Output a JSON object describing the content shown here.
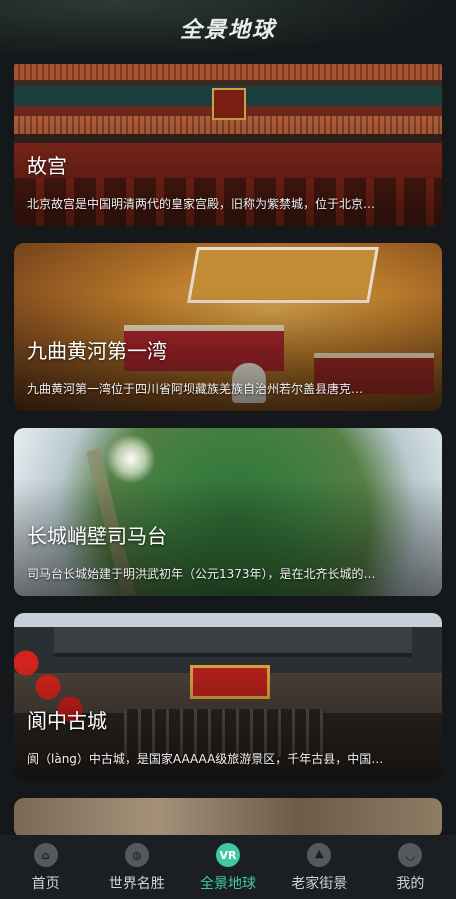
{
  "header": {
    "title": "全景地球"
  },
  "cards": [
    {
      "name": "故宫",
      "desc": "北京故宫是中国明清两代的皇家宫殿，旧称为紫禁城，位于北京…"
    },
    {
      "name": "九曲黄河第一湾",
      "desc": "九曲黄河第一湾位于四川省阿坝藏族羌族自治州若尔盖县唐克…"
    },
    {
      "name": "长城峭壁司马台",
      "desc": "司马台长城始建于明洪武初年（公元1373年），是在北齐长城的…"
    },
    {
      "name": "阆中古城",
      "desc": "阆（làng）中古城，是国家AAAAA级旅游景区，千年古县，中国…"
    }
  ],
  "nav": {
    "items": [
      {
        "label": "首页",
        "icon": "home-icon",
        "glyph": "⌂"
      },
      {
        "label": "世界名胜",
        "icon": "planet-icon",
        "glyph": "◍"
      },
      {
        "label": "全景地球",
        "icon": "vr-icon",
        "glyph": "VR"
      },
      {
        "label": "老家街景",
        "icon": "map-icon",
        "glyph": "⛰"
      },
      {
        "label": "我的",
        "icon": "profile-icon",
        "glyph": "◡"
      }
    ],
    "active_index": 2,
    "active_color": "#3ec9a4"
  }
}
